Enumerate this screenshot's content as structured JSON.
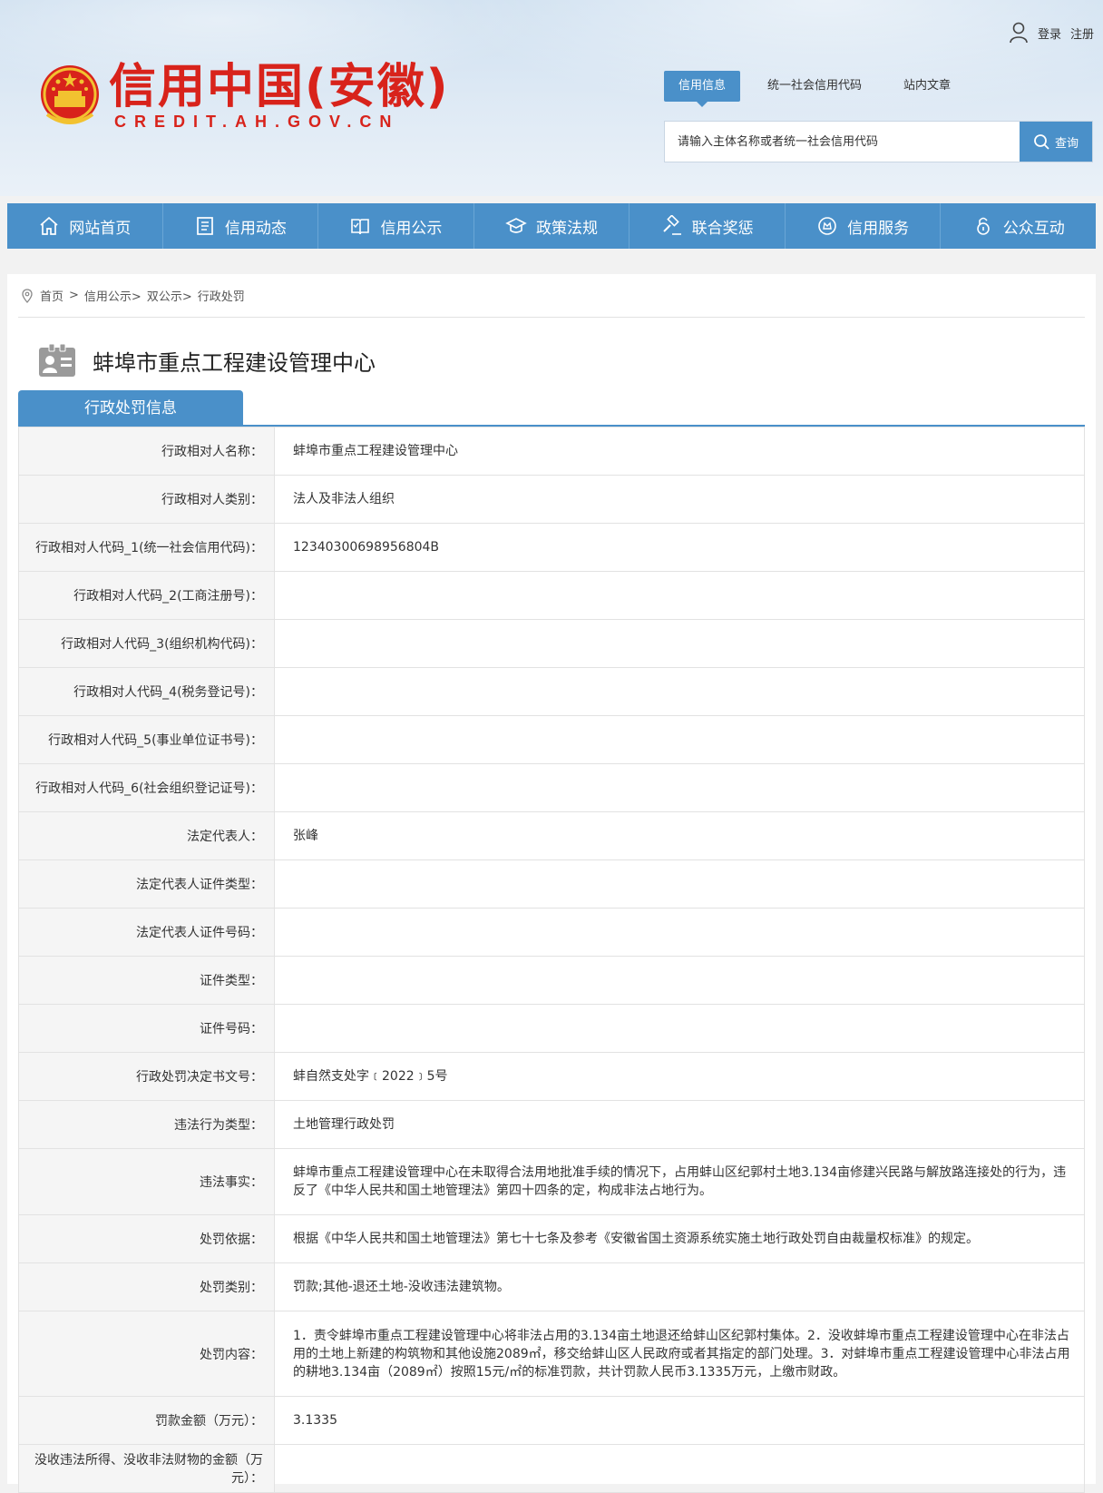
{
  "header": {
    "logo_title": "信用中国(安徽)",
    "logo_sub": "CREDIT.AH.GOV.CN",
    "login": "登录",
    "register": "注册",
    "search_tabs": [
      "信用信息",
      "统一社会信用代码",
      "站内文章"
    ],
    "search_placeholder": "请输入主体名称或者统一社会信用代码",
    "search_button": "查询",
    "colors": {
      "brand_red": "#d8231b",
      "accent_blue": "#4a90c9"
    }
  },
  "nav": [
    {
      "label": "网站首页",
      "icon": "home-icon"
    },
    {
      "label": "信用动态",
      "icon": "document-icon"
    },
    {
      "label": "信用公示",
      "icon": "book-icon"
    },
    {
      "label": "政策法规",
      "icon": "graduation-icon"
    },
    {
      "label": "联合奖惩",
      "icon": "gavel-icon"
    },
    {
      "label": "信用服务",
      "icon": "service-icon"
    },
    {
      "label": "公众互动",
      "icon": "lock-icon"
    }
  ],
  "breadcrumb": {
    "home": "首页",
    "sep": ">",
    "items": [
      "信用公示>",
      "双公示>",
      "行政处罚"
    ]
  },
  "entity": {
    "name": "蚌埠市重点工程建设管理中心"
  },
  "tab": {
    "label": "行政处罚信息"
  },
  "rows": [
    {
      "label": "行政相对人名称：",
      "value": "蚌埠市重点工程建设管理中心"
    },
    {
      "label": "行政相对人类别：",
      "value": "法人及非法人组织"
    },
    {
      "label": "行政相对人代码_1(统一社会信用代码)：",
      "value": "12340300698956804B"
    },
    {
      "label": "行政相对人代码_2(工商注册号)：",
      "value": ""
    },
    {
      "label": "行政相对人代码_3(组织机构代码)：",
      "value": ""
    },
    {
      "label": "行政相对人代码_4(税务登记号)：",
      "value": ""
    },
    {
      "label": "行政相对人代码_5(事业单位证书号)：",
      "value": ""
    },
    {
      "label": "行政相对人代码_6(社会组织登记证号)：",
      "value": ""
    },
    {
      "label": "法定代表人：",
      "value": "张峰"
    },
    {
      "label": "法定代表人证件类型：",
      "value": ""
    },
    {
      "label": "法定代表人证件号码：",
      "value": ""
    },
    {
      "label": "证件类型：",
      "value": ""
    },
    {
      "label": "证件号码：",
      "value": ""
    },
    {
      "label": "行政处罚决定书文号：",
      "value": "蚌自然支处字﹝2022﹞5号"
    },
    {
      "label": "违法行为类型：",
      "value": "土地管理行政处罚"
    },
    {
      "label": "违法事实：",
      "value": "蚌埠市重点工程建设管理中心在未取得合法用地批准手续的情况下，占用蚌山区纪郭村土地3.134亩修建兴民路与解放路连接处的行为，违反了《中华人民共和国土地管理法》第四十四条的定，构成非法占地行为。"
    },
    {
      "label": "处罚依据：",
      "value": "根据《中华人民共和国土地管理法》第七十七条及参考《安徽省国土资源系统实施土地行政处罚自由裁量权标准》的规定。"
    },
    {
      "label": "处罚类别：",
      "value": "罚款;其他-退还土地-没收违法建筑物。"
    },
    {
      "label": "处罚内容：",
      "value": "1．责令蚌埠市重点工程建设管理中心将非法占用的3.134亩土地退还给蚌山区纪郭村集体。2．没收蚌埠市重点工程建设管理中心在非法占用的土地上新建的构筑物和其他设施2089㎡，移交给蚌山区人民政府或者其指定的部门处理。3．对蚌埠市重点工程建设管理中心非法占用的耕地3.134亩（2089㎡）按照15元/㎡的标准罚款，共计罚款人民币3.1335万元，上缴市财政。"
    },
    {
      "label": "罚款金额（万元）：",
      "value": "3.1335"
    },
    {
      "label": "没收违法所得、没收非法财物的金额（万元）：",
      "value": ""
    }
  ]
}
